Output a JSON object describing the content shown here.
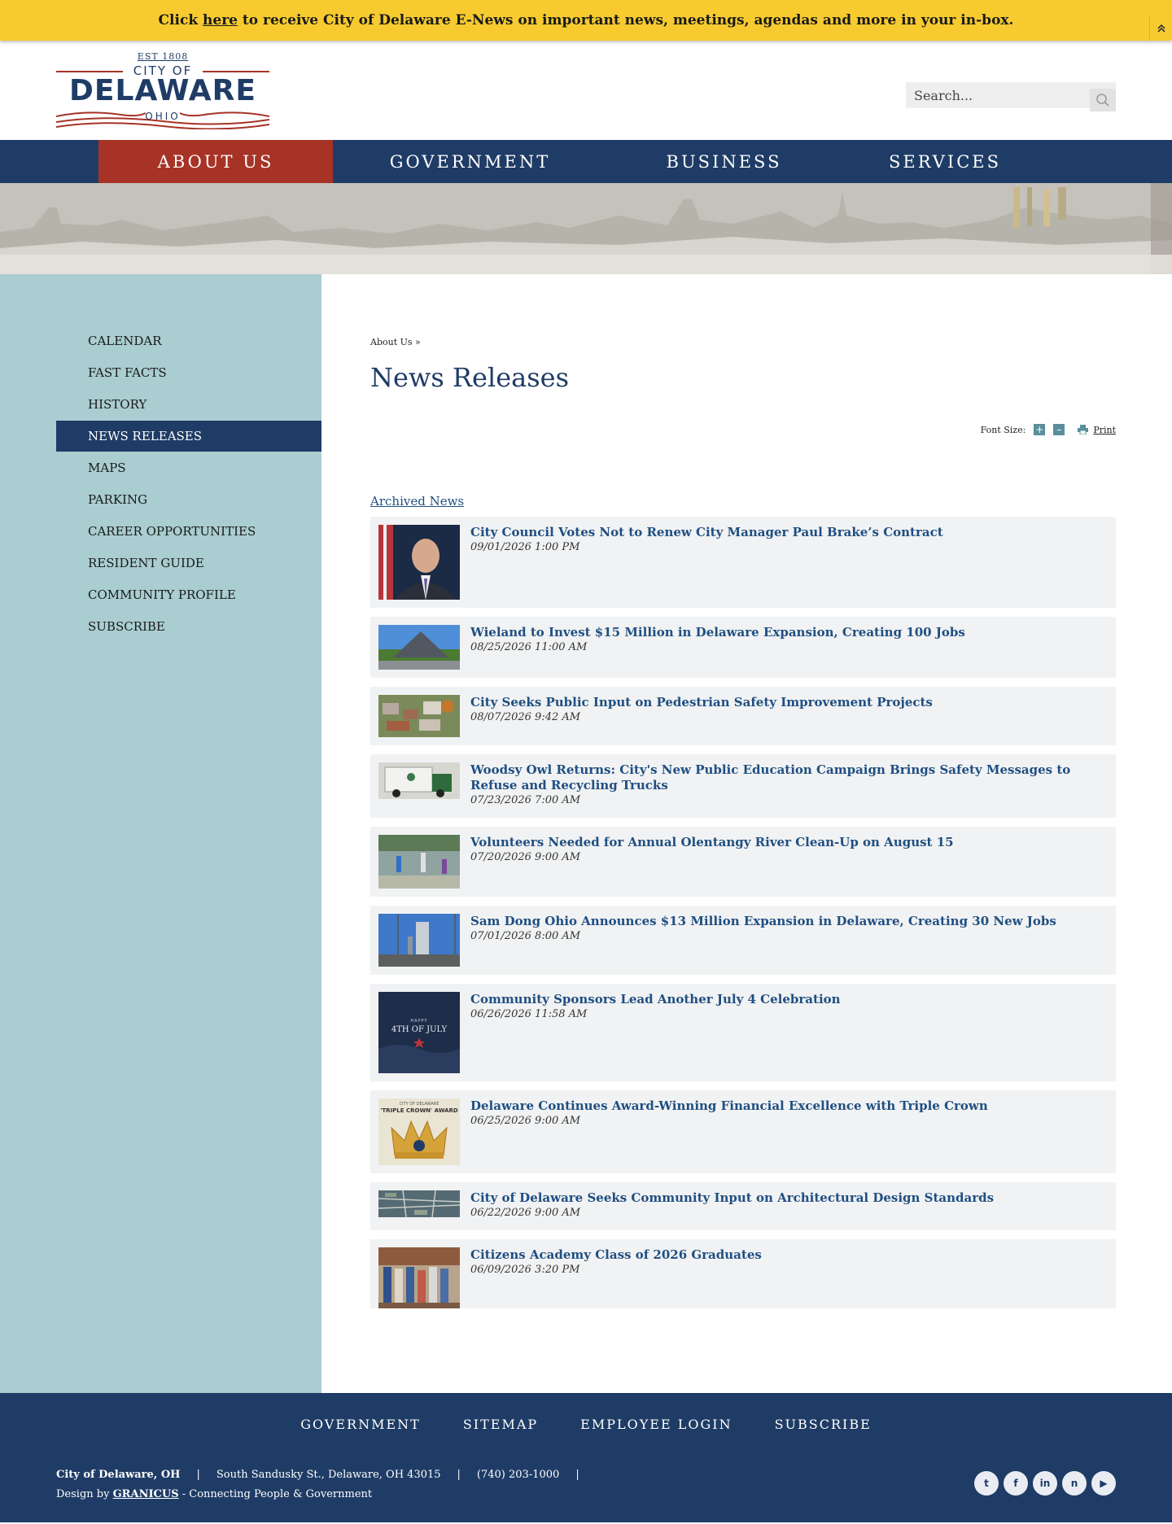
{
  "alert": {
    "prefix": "Click ",
    "link_text": "here",
    "suffix": " to receive City of Delaware E-News on important news, meetings, agendas and more in your in-box.",
    "collapse_icon": "double-chevron-up-icon"
  },
  "logo": {
    "est": "EST 1808",
    "city_of": "CITY OF",
    "name": "DELAWARE",
    "state": "OHIO"
  },
  "search": {
    "placeholder": "Search...",
    "icon": "search-icon"
  },
  "main_nav": [
    {
      "label": "ABOUT US",
      "active": true
    },
    {
      "label": "GOVERNMENT",
      "active": false
    },
    {
      "label": "BUSINESS",
      "active": false
    },
    {
      "label": "SERVICES",
      "active": false
    }
  ],
  "sidebar": [
    {
      "label": "CALENDAR",
      "active": false
    },
    {
      "label": "FAST FACTS",
      "active": false
    },
    {
      "label": "HISTORY",
      "active": false
    },
    {
      "label": "NEWS RELEASES",
      "active": true
    },
    {
      "label": "MAPS",
      "active": false
    },
    {
      "label": "PARKING",
      "active": false
    },
    {
      "label": "CAREER OPPORTUNITIES",
      "active": false
    },
    {
      "label": "RESIDENT GUIDE",
      "active": false
    },
    {
      "label": "COMMUNITY PROFILE",
      "active": false
    },
    {
      "label": "SUBSCRIBE",
      "active": false
    }
  ],
  "breadcrumb": "About Us »",
  "page_title": "News Releases",
  "tools": {
    "font_size_label": "Font Size:",
    "increase": "+",
    "decrease": "–",
    "print_label": "Print"
  },
  "archived_link": "Archived News",
  "news": [
    {
      "title": "City Council Votes Not to Renew City Manager Paul Brake’s Contract",
      "date": "09/01/2026 1:00 PM",
      "thumb": "portrait"
    },
    {
      "title": "Wieland to Invest $15 Million in Delaware Expansion, Creating 100 Jobs",
      "date": "08/25/2026 11:00 AM",
      "thumb": "building"
    },
    {
      "title": "City Seeks Public Input on Pedestrian Safety Improvement Projects",
      "date": "08/07/2026 9:42 AM",
      "thumb": "aerial-town"
    },
    {
      "title": "Woodsy Owl Returns: City's New Public Education Campaign Brings Safety Messages to Refuse and Recycling Trucks",
      "date": "07/23/2026 7:00 AM",
      "thumb": "truck"
    },
    {
      "title": "Volunteers Needed for Annual Olentangy River Clean-Up on August 15",
      "date": "07/20/2026 9:00 AM",
      "thumb": "river"
    },
    {
      "title": "Sam Dong Ohio Announces $13 Million Expansion in Delaware, Creating 30 New Jobs",
      "date": "07/01/2026 8:00 AM",
      "thumb": "tower"
    },
    {
      "title": "Community Sponsors Lead Another July 4 Celebration",
      "date": "06/26/2026 11:58 AM",
      "thumb": "july4",
      "thumb_caption": "4TH OF JULY",
      "thumb_small": "HAPPY"
    },
    {
      "title": "Delaware Continues Award-Winning Financial Excellence with Triple Crown",
      "date": "06/25/2026 9:00 AM",
      "thumb": "crown",
      "thumb_caption": "'TRIPLE CROWN' AWARD",
      "thumb_small": "CITY OF DELAWARE"
    },
    {
      "title": "City of Delaware Seeks Community Input on Architectural Design Standards",
      "date": "06/22/2026 9:00 AM",
      "thumb": "map"
    },
    {
      "title": "Citizens Academy Class of 2026 Graduates",
      "date": "06/09/2026 3:20 PM",
      "thumb": "group"
    }
  ],
  "footer": {
    "nav": [
      "GOVERNMENT",
      "SITEMAP",
      "EMPLOYEE LOGIN",
      "SUBSCRIBE"
    ],
    "org": "City of Delaware, OH",
    "address": "South Sandusky St., Delaware, OH 43015",
    "phone": "(740) 203-1000",
    "separator": "|",
    "credit_prefix": "Design by ",
    "credit_link": "GRANICUS",
    "credit_suffix": " - Connecting People & Government",
    "socials": [
      {
        "icon": "twitter-icon",
        "glyph": "t"
      },
      {
        "icon": "facebook-icon",
        "glyph": "f"
      },
      {
        "icon": "linkedin-icon",
        "glyph": "in"
      },
      {
        "icon": "nextdoor-icon",
        "glyph": "n"
      },
      {
        "icon": "youtube-icon",
        "glyph": "▶"
      }
    ]
  }
}
